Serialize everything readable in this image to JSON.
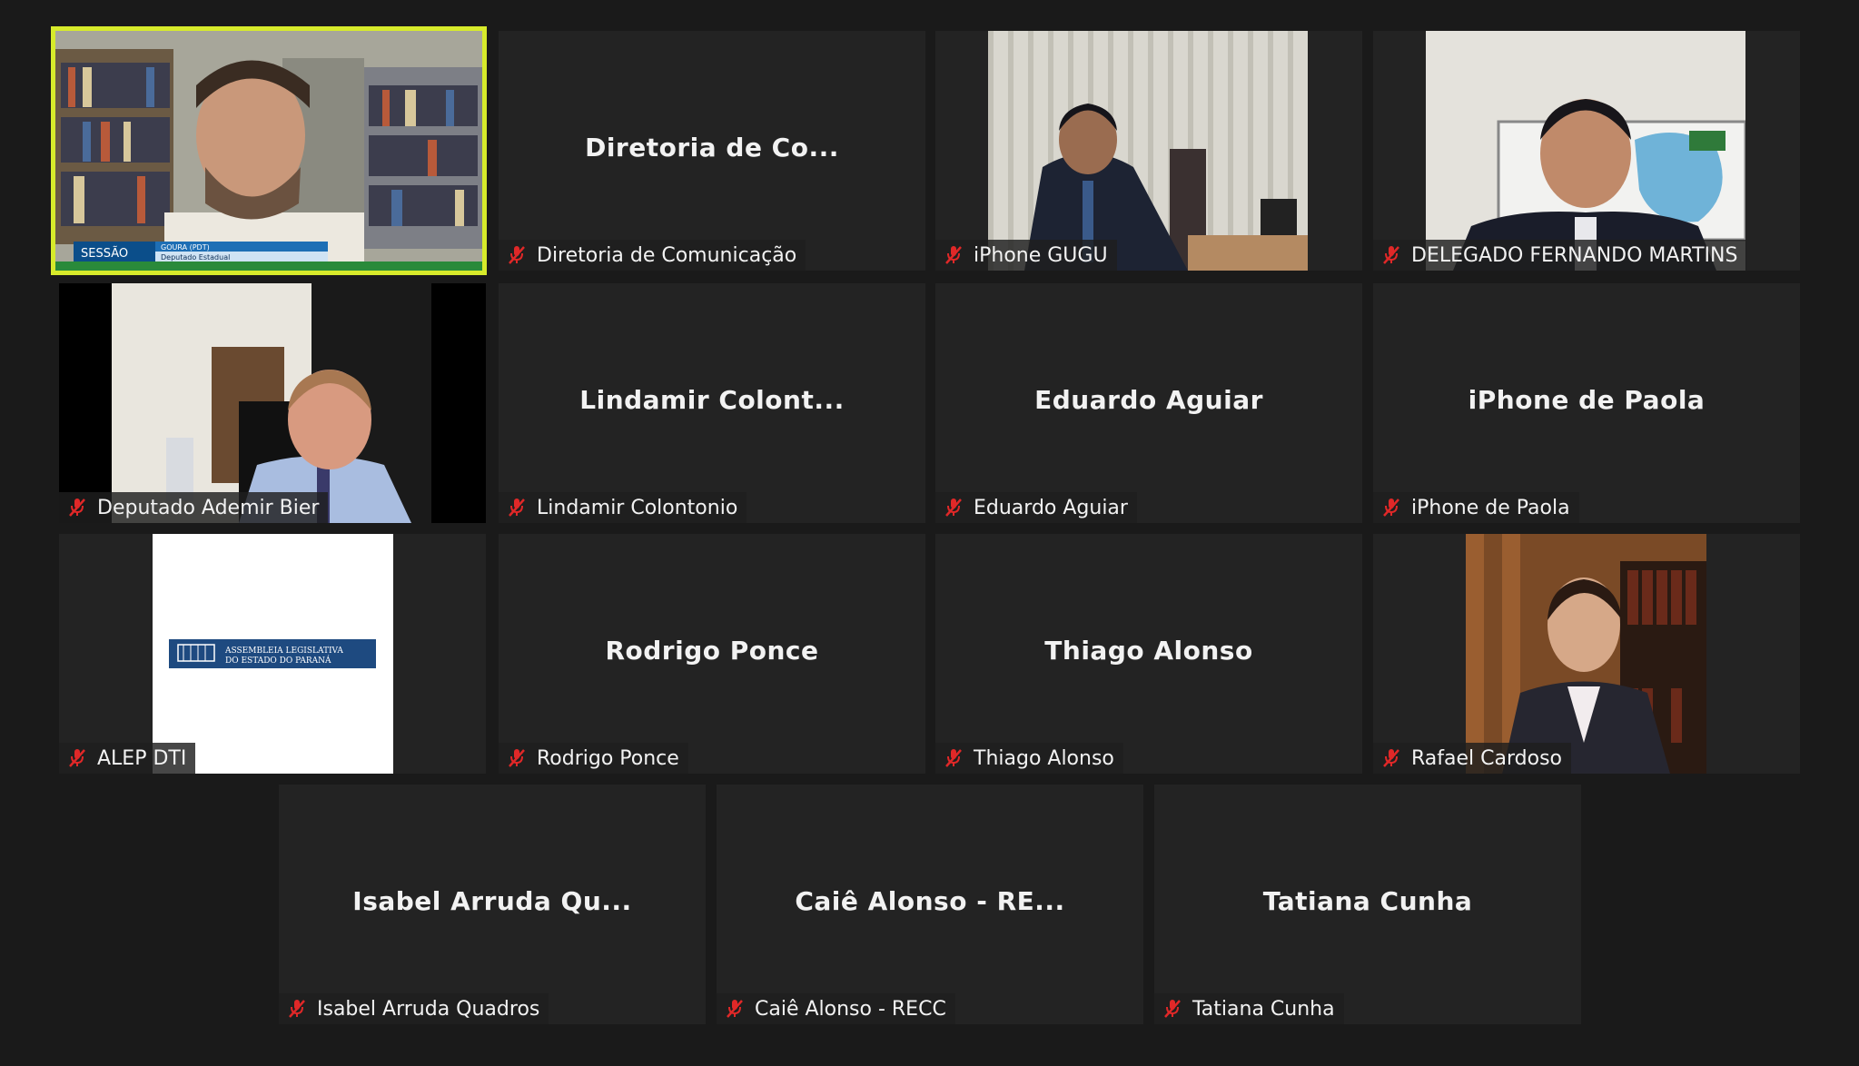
{
  "colors": {
    "background": "#1a1a1a",
    "tile": "#232323",
    "active_speaker_border": "#d7eb2b",
    "mute_icon": "#e02828",
    "name_text": "#f2f2f2"
  },
  "participants": [
    {
      "id": "p1",
      "display_name": "",
      "label": "",
      "video": true,
      "active_speaker": true,
      "muted": false,
      "lower_third": {
        "brand": "SESSÃO",
        "name": "GOURA (PDT)",
        "role": "Deputado Estadual"
      }
    },
    {
      "id": "p2",
      "display_name": "Diretoria de Co...",
      "label": "Diretoria de Comunicação",
      "video": false,
      "muted": true
    },
    {
      "id": "p3",
      "display_name": "",
      "label": "iPhone GUGU",
      "video": true,
      "muted": true
    },
    {
      "id": "p4",
      "display_name": "",
      "label": "DELEGADO FERNANDO MARTINS",
      "video": true,
      "muted": true
    },
    {
      "id": "p5",
      "display_name": "",
      "label": "Deputado Ademir Bier",
      "video": true,
      "muted": true
    },
    {
      "id": "p6",
      "display_name": "Lindamir  Colont...",
      "label": "Lindamir Colontonio",
      "video": false,
      "muted": true
    },
    {
      "id": "p7",
      "display_name": "Eduardo Aguiar",
      "label": "Eduardo Aguiar",
      "video": false,
      "muted": true
    },
    {
      "id": "p8",
      "display_name": "iPhone de Paola",
      "label": "iPhone de Paola",
      "video": false,
      "muted": true
    },
    {
      "id": "p9",
      "display_name": "",
      "label": "ALEP DTI",
      "video": true,
      "muted": true,
      "logo_text": {
        "line1": "ASSEMBLEIA LEGISLATIVA",
        "line2": "DO ESTADO DO PARANÁ"
      }
    },
    {
      "id": "p10",
      "display_name": "Rodrigo Ponce",
      "label": "Rodrigo Ponce",
      "video": false,
      "muted": true
    },
    {
      "id": "p11",
      "display_name": "Thiago Alonso",
      "label": "Thiago Alonso",
      "video": false,
      "muted": true
    },
    {
      "id": "p12",
      "display_name": "",
      "label": "Rafael Cardoso",
      "video": true,
      "muted": true
    },
    {
      "id": "p13",
      "display_name": "Isabel Arruda Qu...",
      "label": "Isabel Arruda Quadros",
      "video": false,
      "muted": true
    },
    {
      "id": "p14",
      "display_name": "Caiê Alonso  -  RE...",
      "label": "Caiê Alonso - RECC",
      "video": false,
      "muted": true
    },
    {
      "id": "p15",
      "display_name": "Tatiana Cunha",
      "label": "Tatiana Cunha",
      "video": false,
      "muted": true
    }
  ]
}
